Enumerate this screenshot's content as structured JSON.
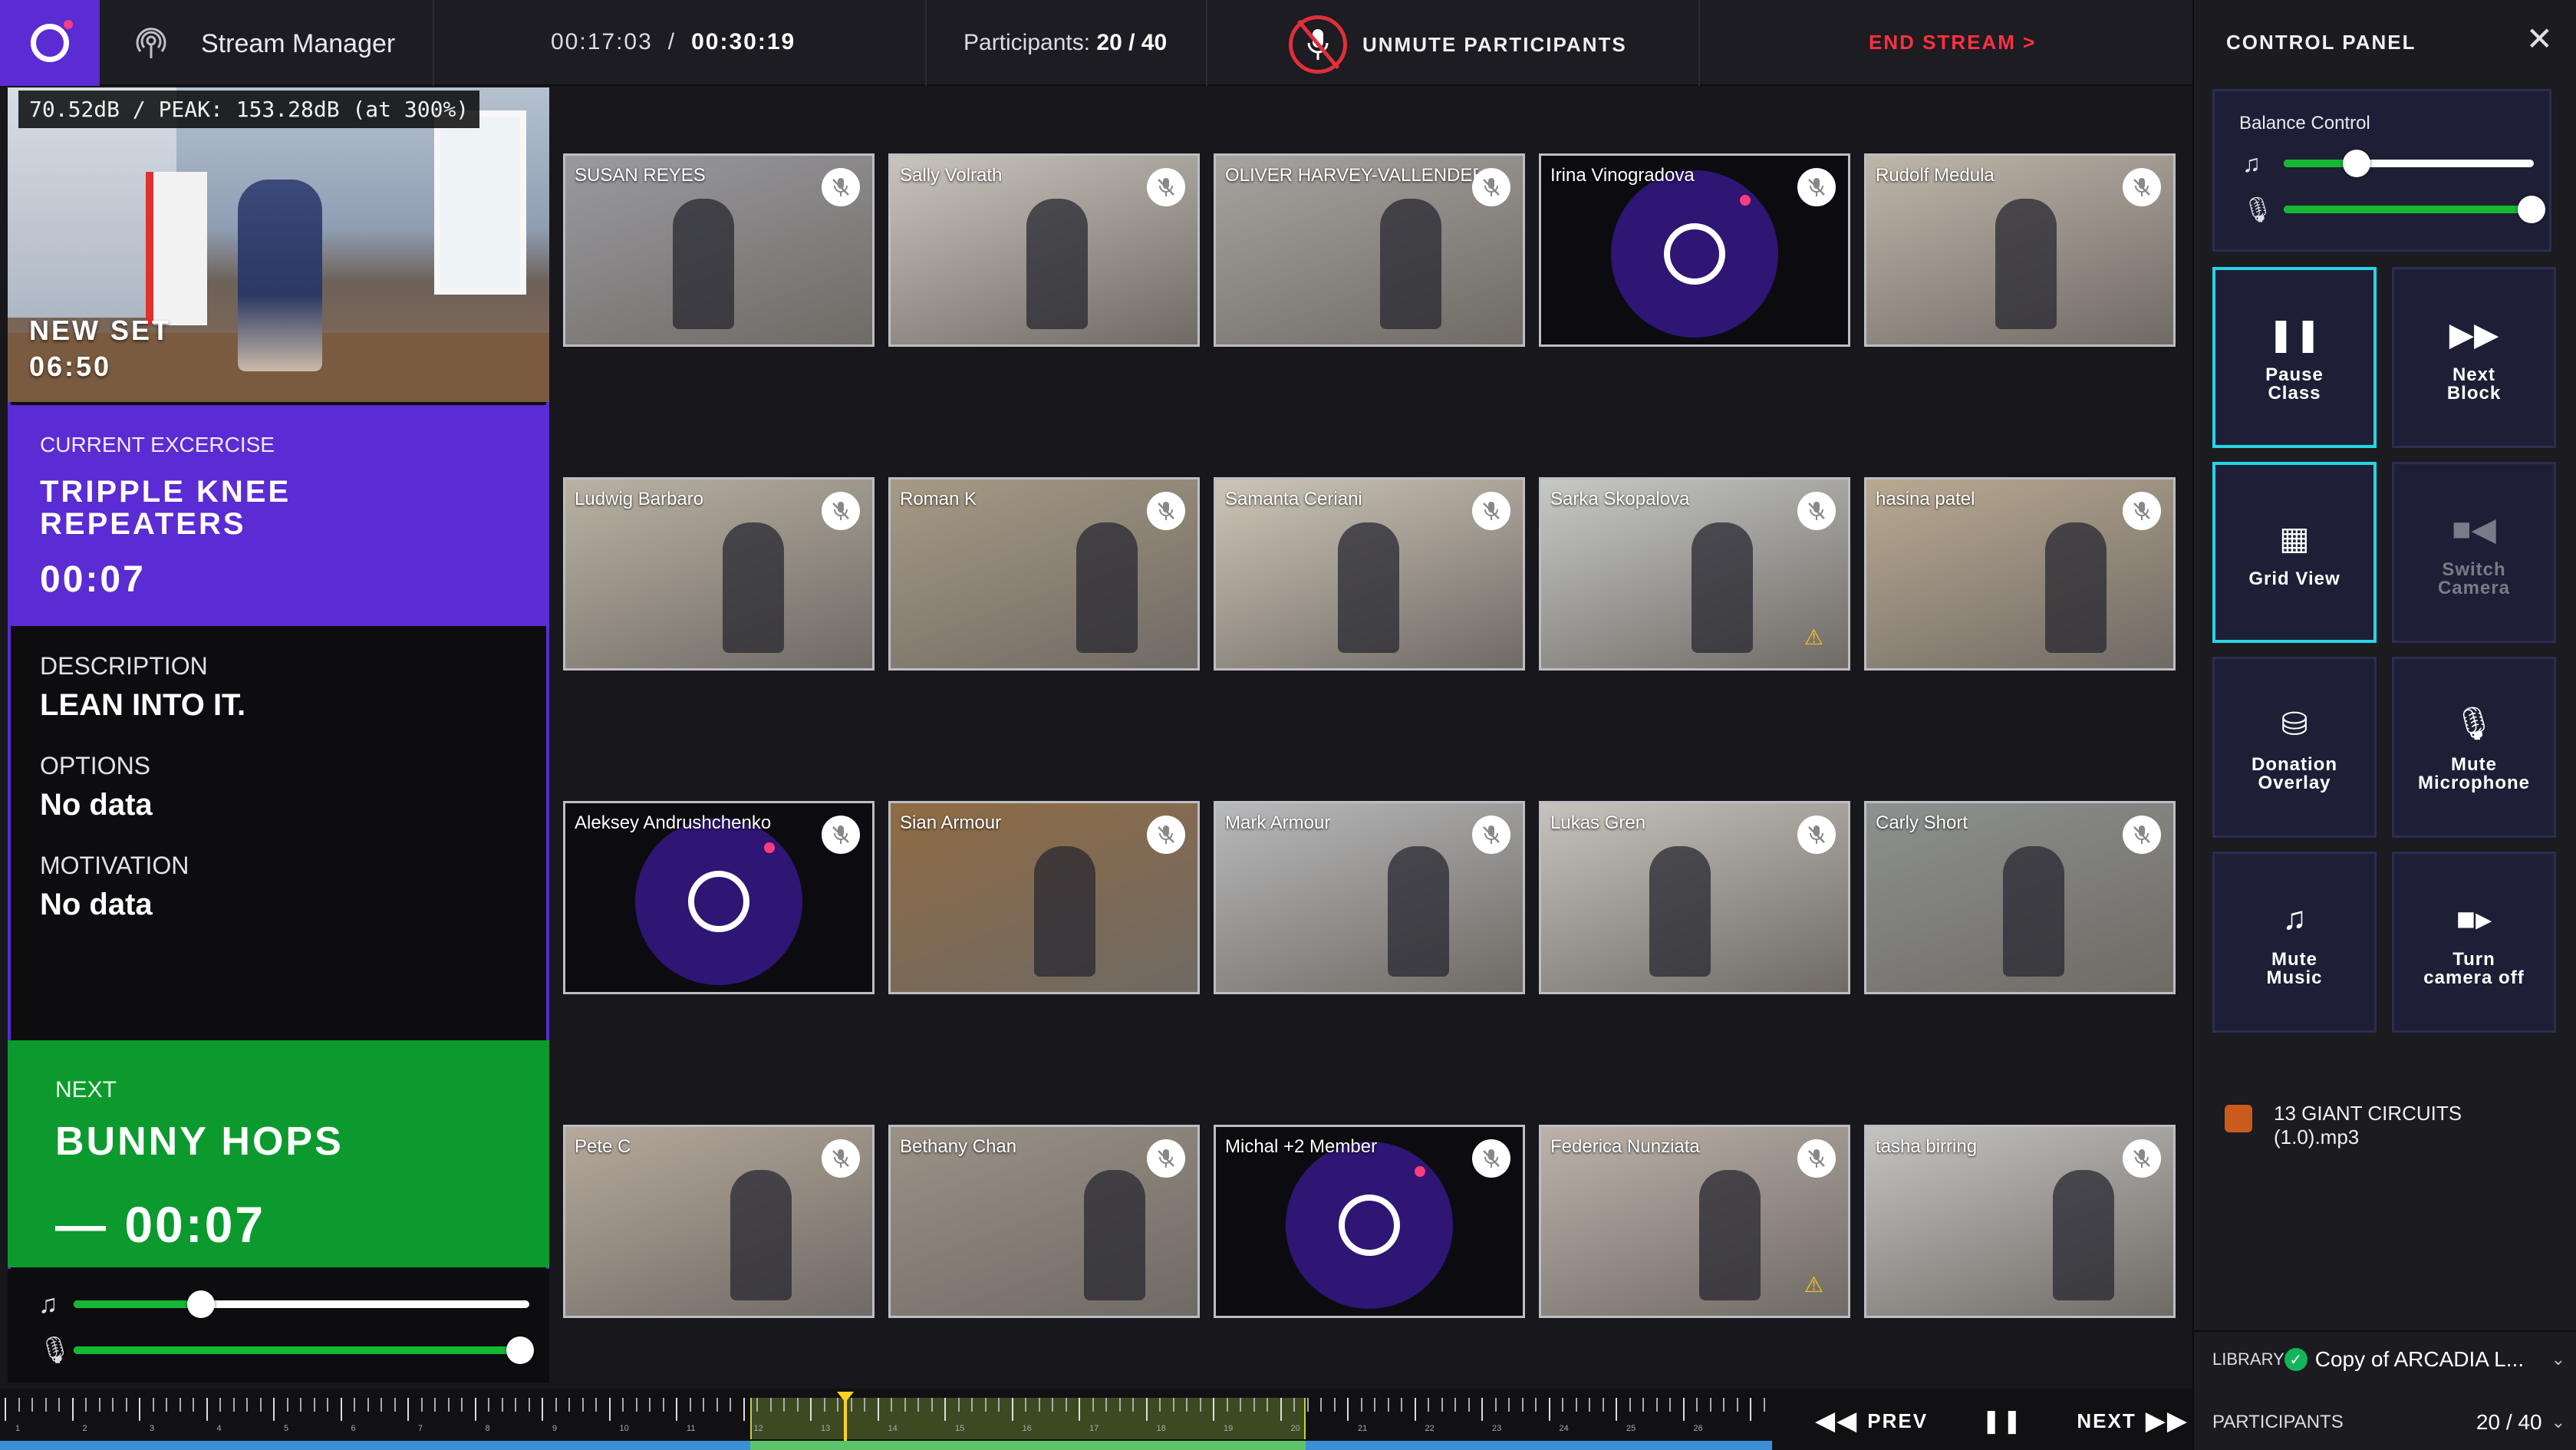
{
  "header": {
    "app_title": "Stream Manager",
    "elapsed": "00:17:03",
    "total": "00:30:19",
    "participants_label": "Participants:",
    "participants_value": "20 / 40",
    "unmute_label": "UNMUTE PARTICIPANTS",
    "end_stream_label": "END STREAM >"
  },
  "preview": {
    "db_readout": "70.52dB / PEAK: 153.28dB (at 300%)",
    "set_label": "NEW SET",
    "set_time": "06:50"
  },
  "current_exercise": {
    "label": "CURRENT EXCERCISE",
    "name_line1": "TRIPPLE KNEE",
    "name_line2": "REPEATERS",
    "time": "00:07"
  },
  "details": {
    "description_label": "DESCRIPTION",
    "description_value": "LEAN INTO IT.",
    "options_label": "OPTIONS",
    "options_value": "No data",
    "motivation_label": "MOTIVATION",
    "motivation_value": "No data"
  },
  "next_exercise": {
    "label": "NEXT",
    "name": "BUNNY HOPS",
    "time": "— 00:07"
  },
  "left_sliders": {
    "music_icon": "music-note-icon",
    "mic_icon": "microphone-icon",
    "music_level": 0.28,
    "mic_level": 0.98
  },
  "participants": [
    {
      "name": "SUSAN REYES",
      "avatar": false,
      "warning": false,
      "bg": "#9a9aa0"
    },
    {
      "name": "Sally Volrath",
      "avatar": false,
      "warning": false,
      "bg": "#c9c4bc"
    },
    {
      "name": "OLIVER HARVEY-VALLENDER",
      "avatar": false,
      "warning": false,
      "bg": "#a7a39f"
    },
    {
      "name": "Irina Vinogradova",
      "avatar": true,
      "warning": false,
      "bg": "#0c0c10"
    },
    {
      "name": "Rudolf Medula",
      "avatar": false,
      "warning": false,
      "bg": "#bfb6aa"
    },
    {
      "name": "Ludwig Barbaro",
      "avatar": false,
      "warning": false,
      "bg": "#b9b2a4"
    },
    {
      "name": "Roman K",
      "avatar": false,
      "warning": false,
      "bg": "#a79a85"
    },
    {
      "name": "Samanta Ceriani",
      "avatar": false,
      "warning": false,
      "bg": "#ccc5b7"
    },
    {
      "name": "Sarka Skopalova",
      "avatar": false,
      "warning": true,
      "bg": "#c7c9c6"
    },
    {
      "name": "hasina patel",
      "avatar": false,
      "warning": false,
      "bg": "#b9a992"
    },
    {
      "name": "Aleksey Andrushchenko",
      "avatar": true,
      "warning": false,
      "bg": "#0c0c10"
    },
    {
      "name": "Sian Armour",
      "avatar": false,
      "warning": false,
      "bg": "#8f6b44"
    },
    {
      "name": "Mark Armour",
      "avatar": false,
      "warning": false,
      "bg": "#b8b9bb"
    },
    {
      "name": "Lukas Gren",
      "avatar": false,
      "warning": false,
      "bg": "#c6c3bc"
    },
    {
      "name": "Carly Short",
      "avatar": false,
      "warning": false,
      "bg": "#8d918f"
    },
    {
      "name": "Pete C",
      "avatar": false,
      "warning": false,
      "bg": "#b6a99c"
    },
    {
      "name": "Bethany Chan",
      "avatar": false,
      "warning": false,
      "bg": "#9b9287"
    },
    {
      "name": "Michal +2 Member",
      "avatar": true,
      "warning": false,
      "bg": "#0c0c10"
    },
    {
      "name": "Federica Nunziata",
      "avatar": false,
      "warning": true,
      "bg": "#bcb2a9"
    },
    {
      "name": "tasha birring",
      "avatar": false,
      "warning": false,
      "bg": "#c5c3c2"
    }
  ],
  "control_panel": {
    "title": "CONTROL PANEL",
    "balance_title": "Balance Control",
    "music_balance": 0.29,
    "mic_balance": 0.99,
    "buttons": [
      {
        "line1": "Pause",
        "line2": "Class",
        "icon": "pause-icon",
        "active": true,
        "disabled": false
      },
      {
        "line1": "Next",
        "line2": "Block",
        "icon": "fast-forward-icon",
        "active": false,
        "disabled": false
      },
      {
        "line1": "Grid View",
        "line2": "",
        "icon": "grid-icon",
        "active": true,
        "disabled": false
      },
      {
        "line1": "Switch",
        "line2": "Camera",
        "icon": "camera-icon",
        "active": false,
        "disabled": true
      },
      {
        "line1": "Donation",
        "line2": "Overlay",
        "icon": "coins-icon",
        "active": false,
        "disabled": false
      },
      {
        "line1": "Mute",
        "line2": "Microphone",
        "icon": "microphone-icon",
        "active": false,
        "disabled": false
      },
      {
        "line1": "Mute",
        "line2": "Music",
        "icon": "music-note-icon",
        "active": false,
        "disabled": false
      },
      {
        "line1": "Turn",
        "line2": "camera off",
        "icon": "video-camera-icon",
        "active": false,
        "disabled": false
      }
    ],
    "track_line1": "13 GIANT CIRCUITS",
    "track_line2": "(1.0).mp3",
    "library_label": "LIBRARY",
    "library_value": "Copy of ARCADIA L...",
    "participants_label": "PARTICIPANTS",
    "participants_value": "20 / 40"
  },
  "timeline": {
    "prev_label": "PREV",
    "next_label": "NEXT",
    "tick_labels": [
      "1",
      "2",
      "3",
      "4",
      "5",
      "6",
      "7",
      "8",
      "9",
      "10",
      "11",
      "12",
      "13",
      "14",
      "15",
      "16",
      "17",
      "18",
      "19",
      "20",
      "21",
      "22",
      "23",
      "24",
      "25",
      "26"
    ]
  },
  "colors": {
    "brand_purple": "#5b2bd3",
    "next_green": "#0c9a2f",
    "danger_red": "#e12f39",
    "active_cyan": "#27d4e4"
  }
}
